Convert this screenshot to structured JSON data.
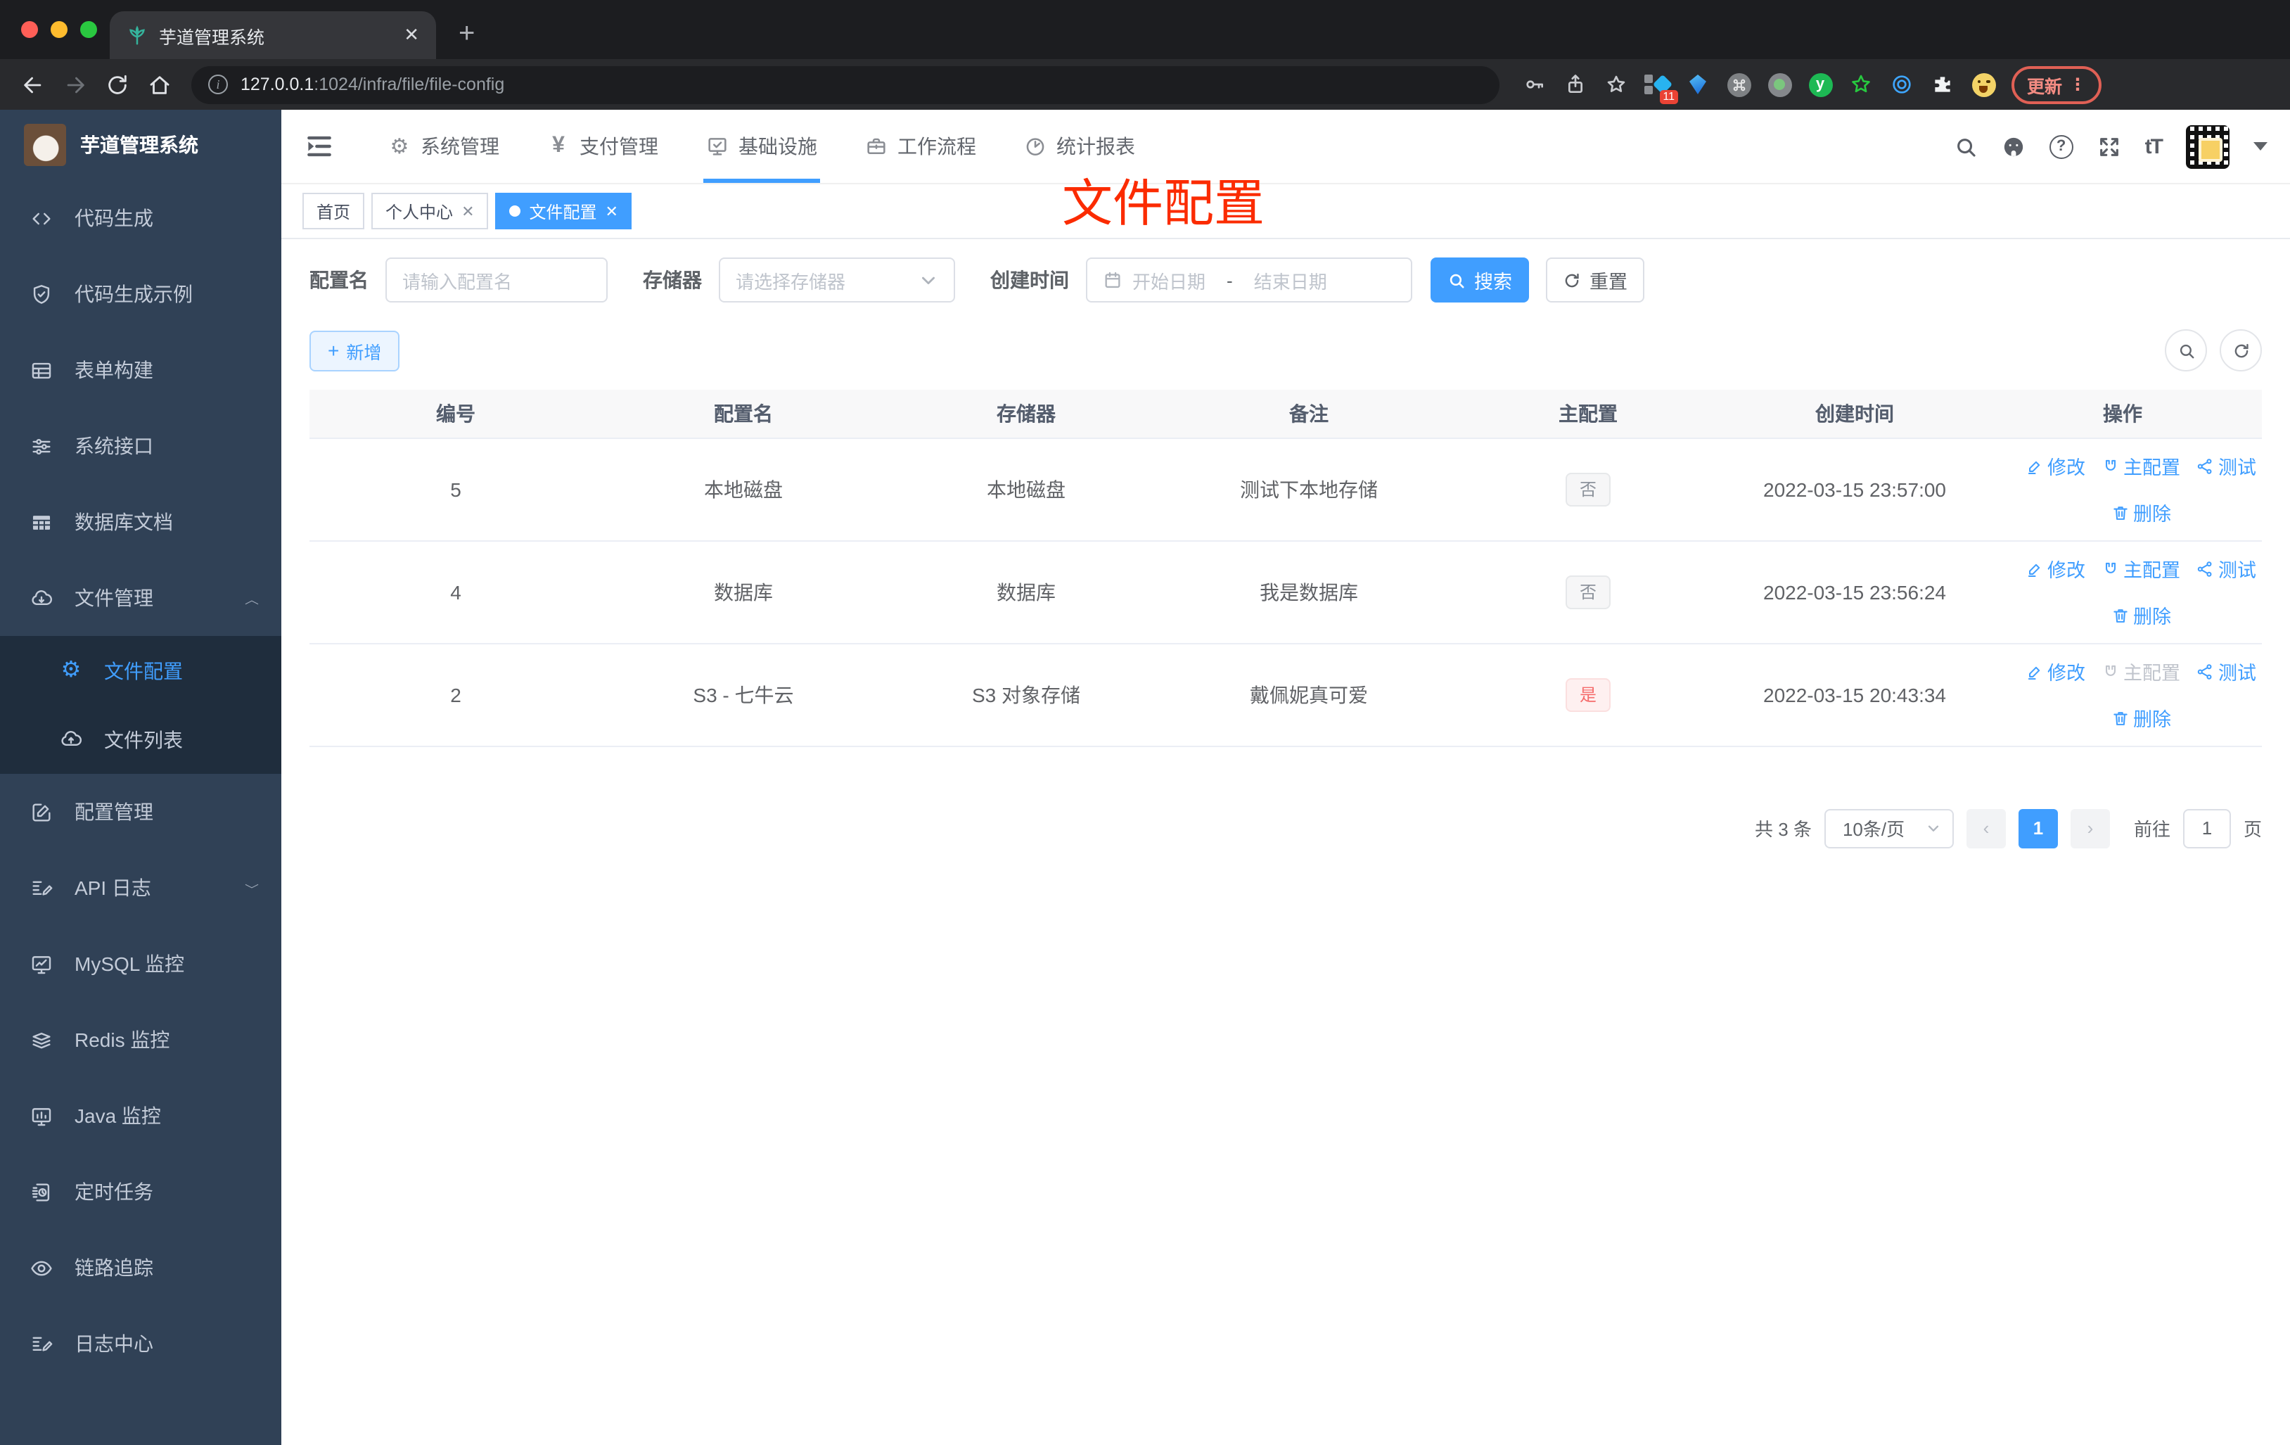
{
  "colors": {
    "accent": "#409eff",
    "annotation_red": "#fb2b00",
    "tag_danger": "#f56c6c",
    "sidebar_bg": "#304156"
  },
  "browser": {
    "tab_title": "芋道管理系统",
    "url_host": "127.0.0.1",
    "url_path": ":1024/infra/file/file-config",
    "extension_badge": "11",
    "update_label": "更新"
  },
  "sidebar": {
    "logo_title": "芋道管理系统",
    "items": [
      {
        "label": "代码生成",
        "icon": "code-icon"
      },
      {
        "label": "代码生成示例",
        "icon": "shield-check-icon"
      },
      {
        "label": "表单构建",
        "icon": "form-icon"
      },
      {
        "label": "系统接口",
        "icon": "sliders-icon"
      },
      {
        "label": "数据库文档",
        "icon": "grid-icon"
      },
      {
        "label": "文件管理",
        "icon": "cloud-download-icon",
        "expanded": true,
        "children": [
          {
            "label": "文件配置",
            "icon": "gear-icon",
            "active": true
          },
          {
            "label": "文件列表",
            "icon": "cloud-upload-icon"
          }
        ]
      },
      {
        "label": "配置管理",
        "icon": "edit-square-icon"
      },
      {
        "label": "API 日志",
        "icon": "doc-edit-icon",
        "collapsed": true
      },
      {
        "label": "MySQL 监控",
        "icon": "monitor-chart-icon"
      },
      {
        "label": "Redis 监控",
        "icon": "stack-icon"
      },
      {
        "label": "Java 监控",
        "icon": "monitor-bars-icon"
      },
      {
        "label": "定时任务",
        "icon": "schedule-icon"
      },
      {
        "label": "链路追踪",
        "icon": "eye-icon"
      },
      {
        "label": "日志中心",
        "icon": "log-edit-icon"
      }
    ]
  },
  "topnav": {
    "items": [
      {
        "label": "系统管理",
        "icon": "gear-nav-icon"
      },
      {
        "label": "支付管理",
        "icon": "yen-icon"
      },
      {
        "label": "基础设施",
        "icon": "infra-icon",
        "active": true
      },
      {
        "label": "工作流程",
        "icon": "workflow-icon"
      },
      {
        "label": "统计报表",
        "icon": "report-icon"
      }
    ],
    "font_icon_label": "tT"
  },
  "tags": [
    {
      "label": "首页"
    },
    {
      "label": "个人中心",
      "closable": true
    },
    {
      "label": "文件配置",
      "closable": true,
      "active": true
    }
  ],
  "annotation": "文件配置",
  "filters": {
    "name_label": "配置名",
    "name_placeholder": "请输入配置名",
    "storage_label": "存储器",
    "storage_placeholder": "请选择存储器",
    "date_label": "创建时间",
    "date_start_placeholder": "开始日期",
    "date_separator": "-",
    "date_end_placeholder": "结束日期",
    "search_label": "搜索",
    "reset_label": "重置"
  },
  "toolbar": {
    "add_label": "新增"
  },
  "table": {
    "headers": [
      "编号",
      "配置名",
      "存储器",
      "备注",
      "主配置",
      "创建时间",
      "操作"
    ],
    "actions": {
      "edit": "修改",
      "master": "主配置",
      "test": "测试",
      "delete": "删除"
    },
    "rows": [
      {
        "id": "5",
        "name": "本地磁盘",
        "storage": "本地磁盘",
        "remark": "测试下本地存储",
        "master": "否",
        "master_type": "info",
        "created": "2022-03-15 23:57:00",
        "master_action_disabled": false
      },
      {
        "id": "4",
        "name": "数据库",
        "storage": "数据库",
        "remark": "我是数据库",
        "master": "否",
        "master_type": "info",
        "created": "2022-03-15 23:56:24",
        "master_action_disabled": false
      },
      {
        "id": "2",
        "name": "S3 - 七牛云",
        "storage": "S3 对象存储",
        "remark": "戴佩妮真可爱",
        "master": "是",
        "master_type": "danger",
        "created": "2022-03-15 20:43:34",
        "master_action_disabled": true
      }
    ]
  },
  "pagination": {
    "total": "共 3 条",
    "page_size": "10条/页",
    "current_page": "1",
    "goto_label": "前往",
    "goto_value": "1",
    "page_unit": "页"
  }
}
